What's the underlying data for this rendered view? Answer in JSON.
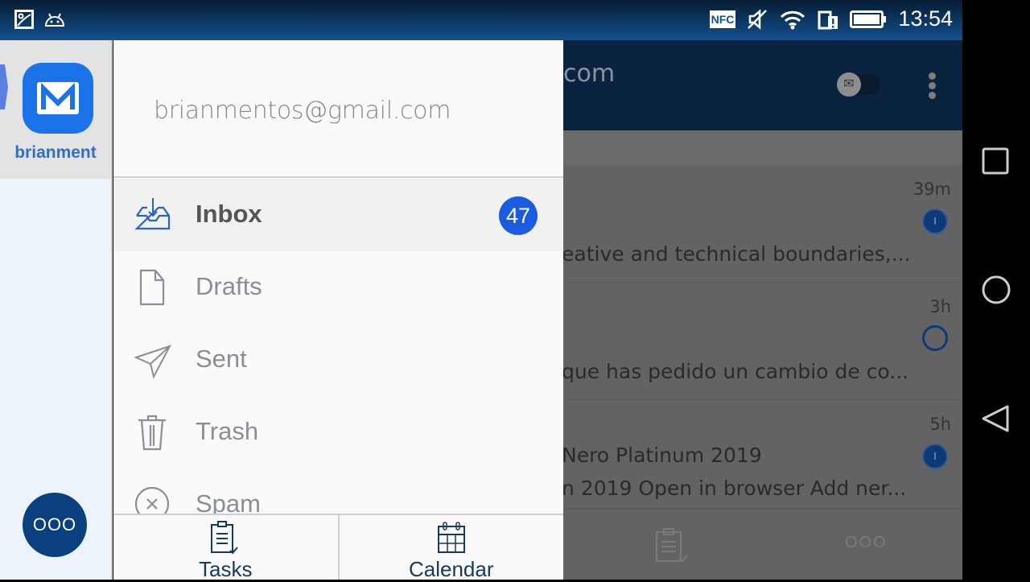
{
  "status_bar": {
    "time": "13:54",
    "icons": [
      "gallery-icon",
      "android-icon",
      "nfc-icon",
      "mute-icon",
      "wifi-icon",
      "sim-alert-icon",
      "battery-icon"
    ],
    "nfc_label": "NFC"
  },
  "account": {
    "name": "brianment",
    "email": "brianmentos@gmail.com",
    "more_label": "OOO"
  },
  "folders": [
    {
      "label": "Inbox",
      "icon": "inbox-icon",
      "count": "47",
      "selected": true
    },
    {
      "label": "Drafts",
      "icon": "draft-icon"
    },
    {
      "label": "Sent",
      "icon": "send-icon"
    },
    {
      "label": "Trash",
      "icon": "trash-icon"
    },
    {
      "label": "Spam",
      "icon": "spam-icon"
    }
  ],
  "bottom_tabs": [
    {
      "label": "Tasks",
      "icon": "tasks-icon"
    },
    {
      "label": "Calendar",
      "icon": "calendar-icon"
    }
  ],
  "background": {
    "title_fragment": "com",
    "more_label": "OOO",
    "messages": [
      {
        "time": "39m",
        "snippet": "eative and technical boundaries,...",
        "status": "filled"
      },
      {
        "time": "3h",
        "snippet": "que has pedido un cambio de co...",
        "status": "empty"
      },
      {
        "time": "5h",
        "subject": "Nero Platinum 2019",
        "snippet": "n 2019 Open in browser Add ner...",
        "status": "filled"
      }
    ]
  },
  "colors": {
    "accent": "#1a73e8",
    "badge": "#1a5be0",
    "navy": "#0b4080"
  }
}
